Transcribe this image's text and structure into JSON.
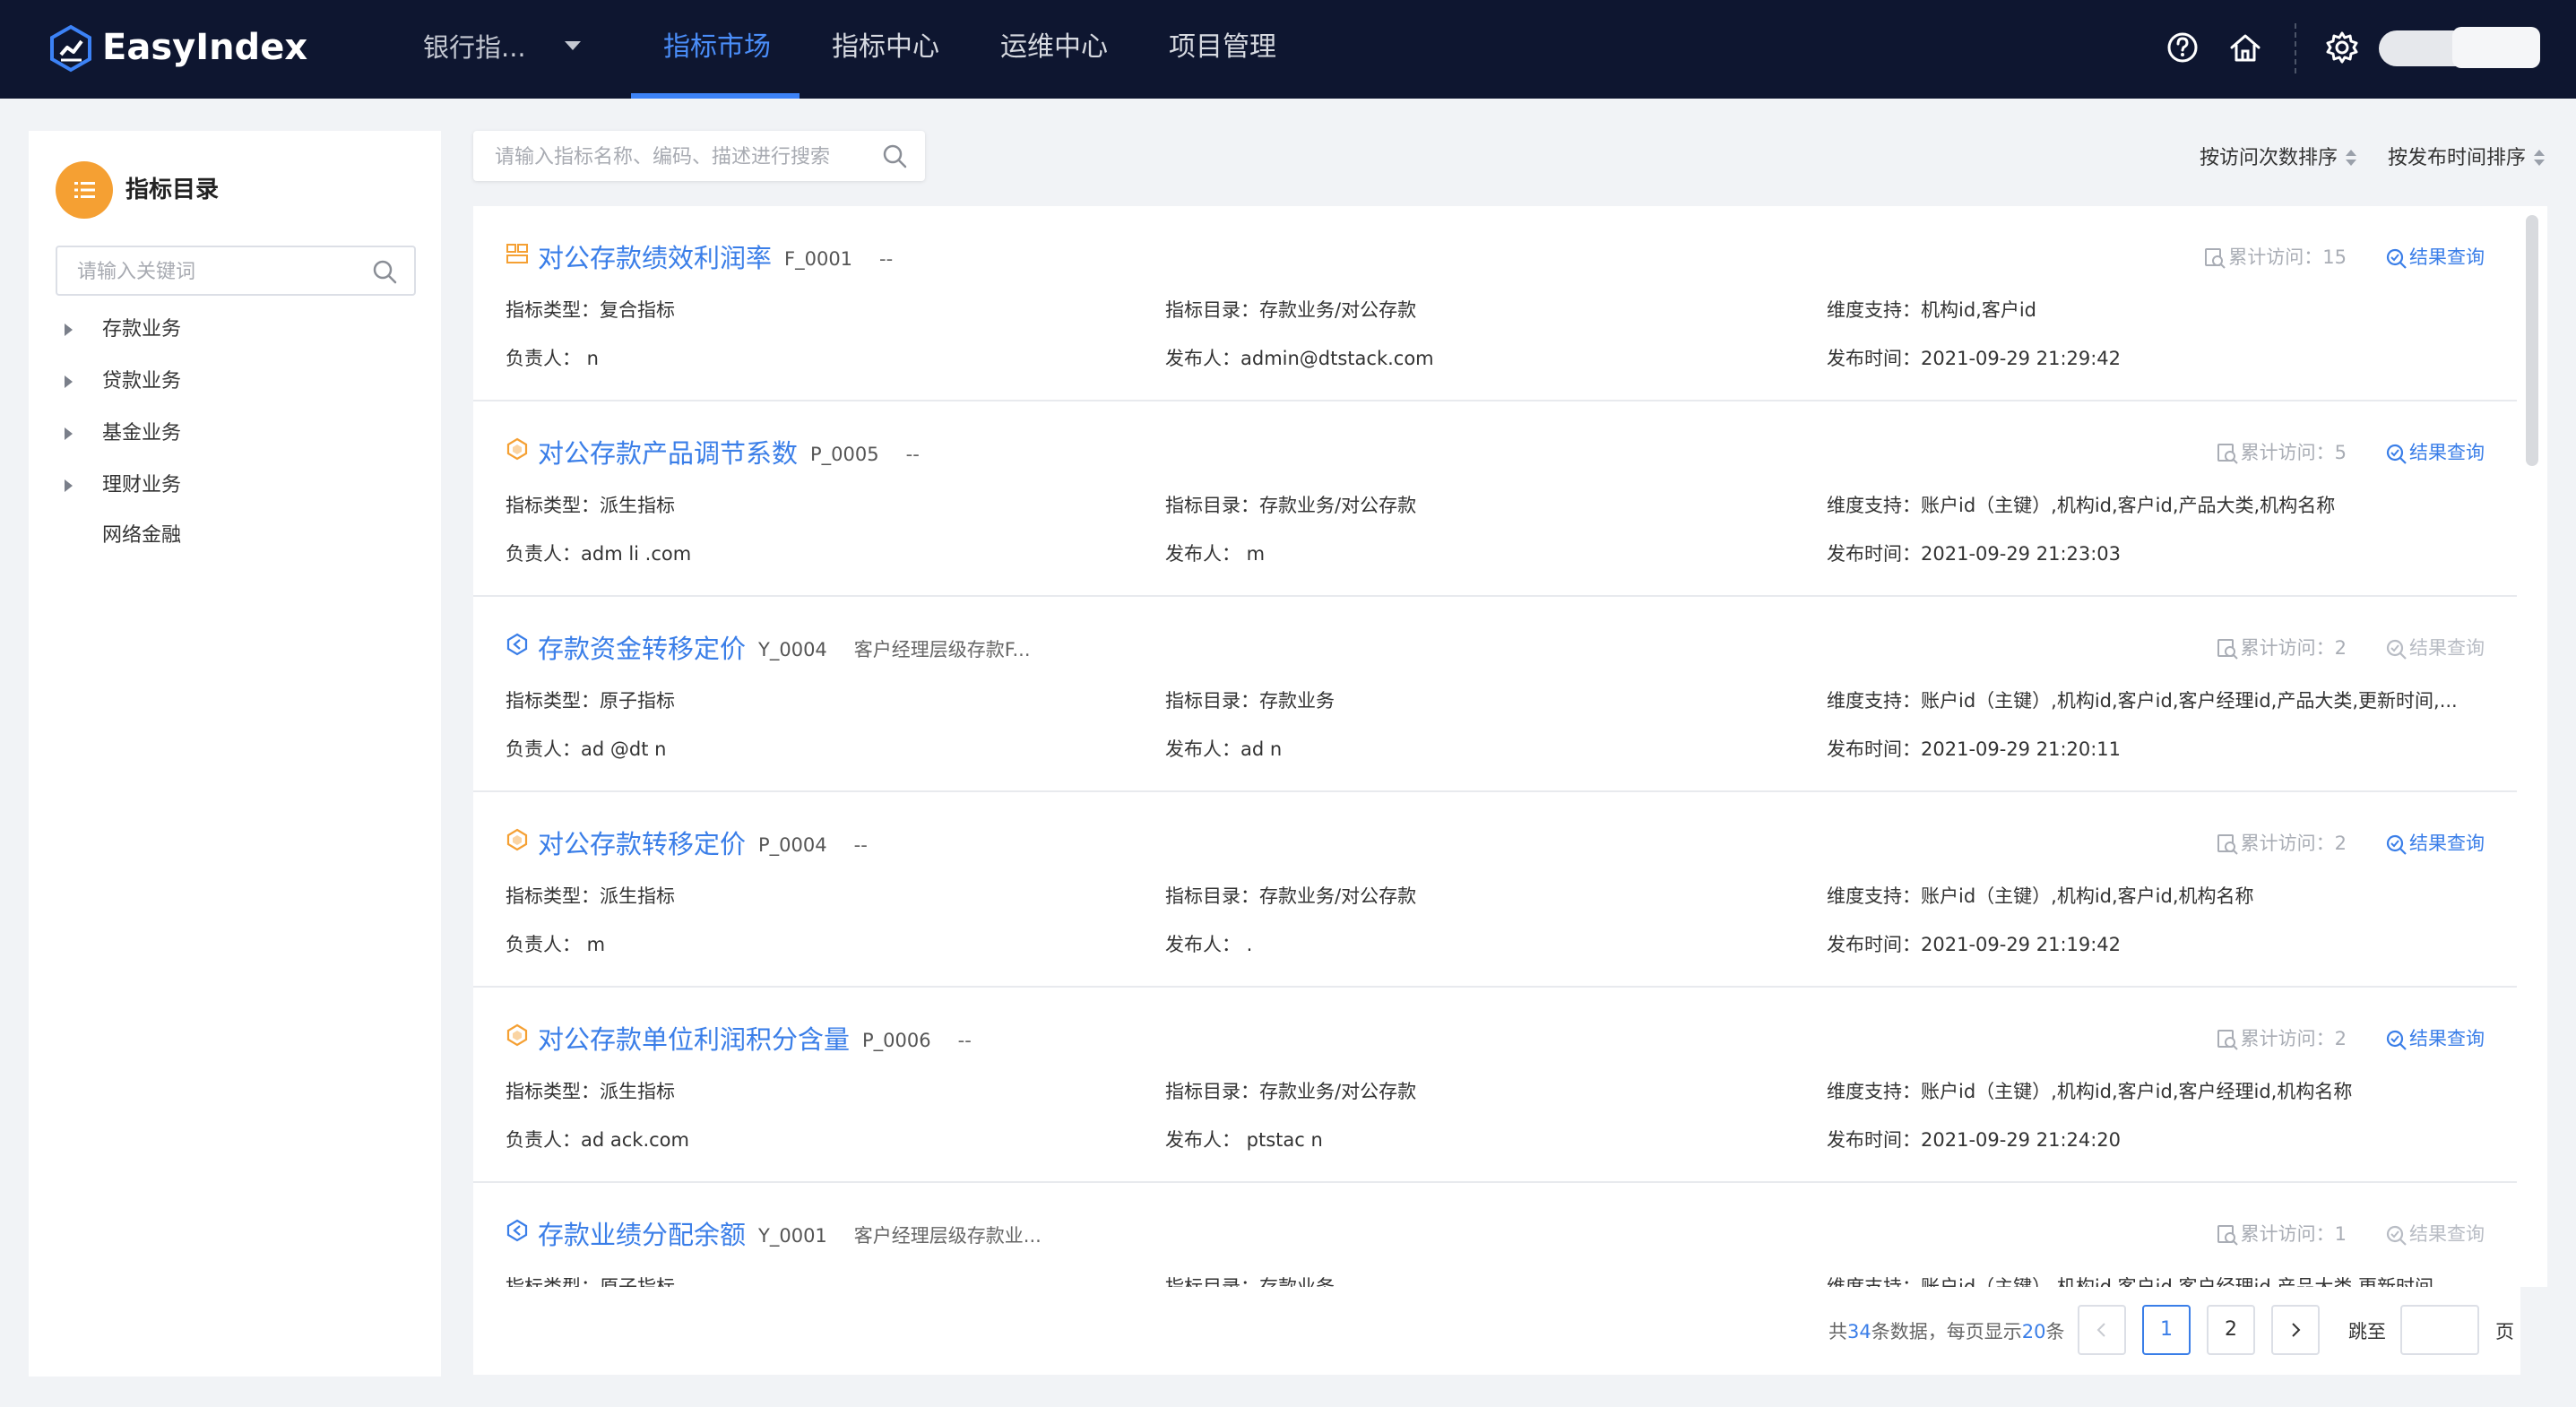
{
  "app": {
    "logo_text": "EasyIndex",
    "bank_select": "银行指...",
    "nav": [
      {
        "label": "指标市场",
        "active": true
      },
      {
        "label": "指标中心",
        "active": false
      },
      {
        "label": "运维中心",
        "active": false
      },
      {
        "label": "项目管理",
        "active": false
      }
    ],
    "icons": [
      "help-icon",
      "home-icon",
      "settings-icon"
    ],
    "accent_color": "#3a7ee8",
    "topbar_color": "#0e1630"
  },
  "sidebar": {
    "title": "指标目录",
    "keyword_placeholder": "请输入关键词",
    "items": [
      {
        "label": "存款业务",
        "expandable": true
      },
      {
        "label": "贷款业务",
        "expandable": true
      },
      {
        "label": "基金业务",
        "expandable": true
      },
      {
        "label": "理财业务",
        "expandable": true
      },
      {
        "label": "网络金融",
        "expandable": false
      }
    ]
  },
  "main": {
    "search_placeholder": "请输入指标名称、编码、描述进行搜索",
    "sort_by_visits": "按访问次数排序",
    "sort_by_publish": "按发布时间排序"
  },
  "labels": {
    "type": "指标类型：",
    "catalog": "指标目录：",
    "dimension": "维度支持：",
    "owner": "负责人：",
    "publisher": "发布人：",
    "publish_time": "发布时间：",
    "visits_prefix": "累计访问：",
    "result_query": "结果查询"
  },
  "cards": [
    {
      "name": "对公存款绩效利润率",
      "code": "F_0001",
      "desc": "--",
      "kind": "composite",
      "visits": "15",
      "result_enabled": true,
      "type": "复合指标",
      "catalog": "存款业务/对公存款",
      "dimension": "机构id,客户id",
      "owner": "                   n",
      "publisher": "admin@dtstack.com",
      "publish_time": "2021-09-29 21:29:42"
    },
    {
      "name": "对公存款产品调节系数",
      "code": "P_0005",
      "desc": "--",
      "kind": "derived",
      "visits": "5",
      "result_enabled": true,
      "type": "派生指标",
      "catalog": "存款业务/对公存款",
      "dimension": "账户id（主键）,机构id,客户id,产品大类,机构名称",
      "owner": "adm      li     .com",
      "publisher": "                  m",
      "publish_time": "2021-09-29 21:23:03"
    },
    {
      "name": "存款资金转移定价",
      "code": "Y_0004",
      "desc": "客户经理层级存款F...",
      "kind": "atomic",
      "visits": "2",
      "result_enabled": false,
      "type": "原子指标",
      "catalog": "存款业务",
      "dimension": "账户id（主键）,机构id,客户id,客户经理id,产品大类,更新时间,...",
      "owner": "ad    @dt         n",
      "publisher": "ad              n",
      "publish_time": "2021-09-29 21:20:11"
    },
    {
      "name": "对公存款转移定价",
      "code": "P_0004",
      "desc": "--",
      "kind": "derived",
      "visits": "2",
      "result_enabled": true,
      "type": "派生指标",
      "catalog": "存款业务/对公存款",
      "dimension": "账户id（主键）,机构id,客户id,机构名称",
      "owner": "                  m",
      "publisher": "                   .",
      "publish_time": "2021-09-29 21:19:42"
    },
    {
      "name": "对公存款单位利润积分含量",
      "code": "P_0006",
      "desc": "--",
      "kind": "derived",
      "visits": "2",
      "result_enabled": true,
      "type": "派生指标",
      "catalog": "存款业务/对公存款",
      "dimension": "账户id（主键）,机构id,客户id,客户经理id,机构名称",
      "owner": "ad        ack.com",
      "publisher": "           ptstac   n",
      "publish_time": "2021-09-29 21:24:20"
    },
    {
      "name": "存款业绩分配余额",
      "code": "Y_0001",
      "desc": "客户经理层级存款业...",
      "kind": "atomic",
      "visits": "1",
      "result_enabled": false,
      "type": "原子指标",
      "catalog": "存款业务",
      "dimension": "账户id（主键）,机构id,客户id,客户经理id,产品大类,更新时间",
      "owner": "",
      "publisher": "",
      "publish_time": ""
    }
  ],
  "pagination": {
    "total_prefix": "共",
    "total": "34",
    "total_mid": "条数据，每页显示",
    "page_size": "20",
    "total_suffix": "条",
    "pages": [
      "1",
      "2"
    ],
    "current": "1",
    "jump_label": "跳至",
    "page_unit": "页"
  }
}
